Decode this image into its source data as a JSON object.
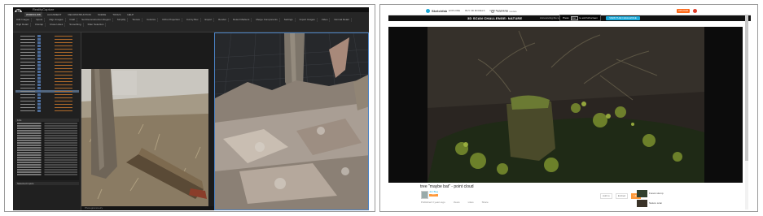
{
  "left_app": {
    "window_title": "RealityCapture",
    "tabs": [
      "WORKFLOW",
      "ALIGNMENT",
      "RECONSTRUCTION",
      "SCENE",
      "TOOLS",
      "HELP"
    ],
    "active_tab": 0,
    "tools": [
      "Add Images",
      "Inputs",
      "Align Images",
      "Draft",
      "Set Reconstruction Region",
      "Simplify",
      "Texture",
      "Colorize",
      "Ortho Projection",
      "Cut by Box",
      "Export",
      "Render",
      "Detect Markers",
      "Merge Components",
      "Settings",
      "Import Images",
      "Video",
      "Normal Detail",
      "High Detail",
      "Unwrap",
      "Close Holes",
      "Smoothing",
      "Filter Selection"
    ],
    "panel_titles": [
      "1Ds",
      "Selected inputs"
    ],
    "status": "Photogrammetry"
  },
  "right_page": {
    "brand": "Sketchfab",
    "nav": [
      "EXPLORE",
      "BUY 3D MODELS",
      "FOR BUSINESS"
    ],
    "search_placeholder": "Search 3D models",
    "upload_label": "UPLOAD",
    "banner_text": "3D SCAN CHALLENGE: NATURE",
    "banner_sub": "Announcing the winners. Get your nature scans included",
    "banner_button": "VIEW THE CHALLENGE",
    "tooltip_prefix": "Press",
    "tooltip_key": "Esc",
    "tooltip_suffix": "to exit full screen",
    "model_title": "tree \"maybe bat\" - point cloud",
    "author": "Jon Bug",
    "badge": "PRO",
    "meta": [
      "Published 3 years ago",
      "Views",
      "Likes",
      "Share"
    ],
    "actions": [
      "Add to",
      "Embed",
      "Like"
    ],
    "related": [
      {
        "title": "Forest stump"
      },
      {
        "title": "Nature scan"
      }
    ]
  },
  "colors": {
    "accent_blue": "#1caad9",
    "orange": "#ff6b1a",
    "app_bg": "#1b1b1b"
  }
}
